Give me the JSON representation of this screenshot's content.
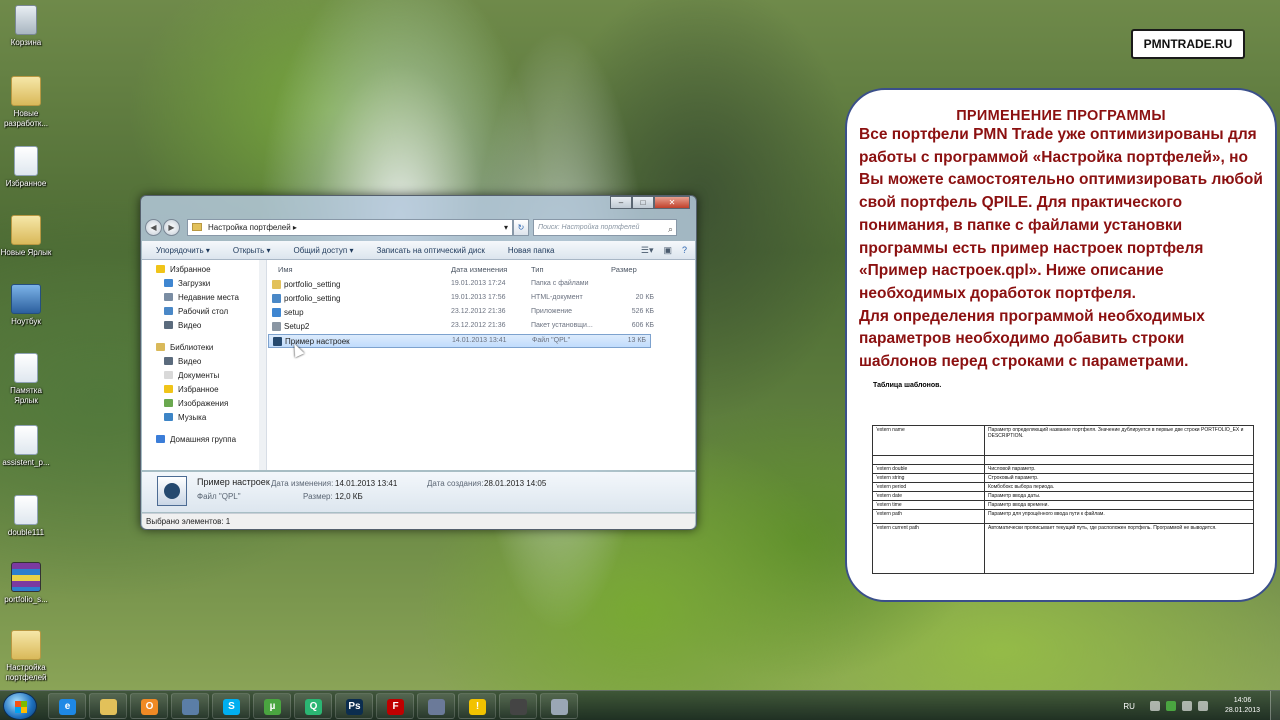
{
  "desktop_icons": [
    {
      "label": "Корзина",
      "kind": "bin"
    },
    {
      "label": "Новые разработк...",
      "kind": "folder"
    },
    {
      "label": "Избранное",
      "kind": "doc"
    },
    {
      "label": "Новые Ярлык",
      "kind": "folder"
    },
    {
      "label": "Ноутбук",
      "kind": "pc"
    },
    {
      "label": "Памятка Ярлык",
      "kind": "doc"
    },
    {
      "label": "assistent_p...",
      "kind": "doc"
    },
    {
      "label": "double111",
      "kind": "doc"
    },
    {
      "label": "portfolio_s...",
      "kind": "zip"
    },
    {
      "label": "Настройка портфелей",
      "kind": "folder"
    }
  ],
  "badge": "PMNTRADE.RU",
  "info": {
    "heading": "ПРИМЕНЕНИЕ ПРОГРАММЫ",
    "paragraph1": "Все портфели PMN Trade уже оптимизированы для работы с программой «Настройка портфелей», но Вы можете самостоятельно оптимизировать любой свой портфель QPILE. Для практического понимания, в папке с файлами установки программы есть пример настроек портфеля «Пример настроек.qpl». Ниже описание необходимых доработок портфеля.",
    "paragraph2": "Для определения программой необходимых параметров необходимо добавить строки шаблонов перед строками с параметрами.",
    "table_title": "Таблица шаблонов.",
    "table_rows": [
      {
        "key": "'extern name",
        "desc": "Параметр определяющий название портфеля. Значение дублируется в первые две строки PORTFOLIO_EX и DESCRIPTION."
      },
      {
        "key": "",
        "desc": ""
      },
      {
        "key": "'extern double",
        "desc": "Числовой параметр."
      },
      {
        "key": "'extern string",
        "desc": "Строковый параметр."
      },
      {
        "key": "'extern period",
        "desc": "Комбобокс выбора периода."
      },
      {
        "key": "'extern date",
        "desc": "Параметр ввода даты."
      },
      {
        "key": "'extern time",
        "desc": "Параметр ввода времени."
      },
      {
        "key": "'extern path",
        "desc": "Параметр для упрощённого ввода пути к файлам."
      },
      {
        "key": "'extern current path",
        "desc": "Автоматически прописывает текущий путь, где расположен портфель. Программой не выводится."
      }
    ]
  },
  "explorer": {
    "address": "Настройка портфелей",
    "search_placeholder": "Поиск: Настройка портфелей",
    "toolbar": [
      "Упорядочить ▾",
      "Открыть ▾",
      "Общий доступ ▾",
      "Записать на оптический диск",
      "Новая папка"
    ],
    "nav": [
      {
        "label": "Избранное",
        "level": 0,
        "color": "#f0c419"
      },
      {
        "label": "Загрузки",
        "level": 1,
        "color": "#3f86d1"
      },
      {
        "label": "Недавние места",
        "level": 1,
        "color": "#7a8da3"
      },
      {
        "label": "Рабочий стол",
        "level": 1,
        "color": "#4a88c7"
      },
      {
        "label": "Видео",
        "level": 1,
        "color": "#5b6b7d"
      },
      {
        "label": "",
        "level": -1,
        "color": ""
      },
      {
        "label": "Библиотеки",
        "level": 0,
        "color": "#d9b95a"
      },
      {
        "label": "Видео",
        "level": 1,
        "color": "#5b6b7d"
      },
      {
        "label": "Документы",
        "level": 1,
        "color": "#d9d9d9"
      },
      {
        "label": "Избранное",
        "level": 1,
        "color": "#f0c419"
      },
      {
        "label": "Изображения",
        "level": 1,
        "color": "#6aa84f"
      },
      {
        "label": "Музыка",
        "level": 1,
        "color": "#3d85c6"
      },
      {
        "label": "",
        "level": -1,
        "color": ""
      },
      {
        "label": "Домашняя группа",
        "level": 0,
        "color": "#3b7dd8"
      }
    ],
    "columns": {
      "name": "Имя",
      "date": "Дата изменения",
      "type": "Тип",
      "size": "Размер"
    },
    "files": [
      {
        "name": "portfolio_setting",
        "date": "19.01.2013 17:24",
        "type": "Папка с файлами",
        "size": "",
        "color": "#e2c15a",
        "selected": false
      },
      {
        "name": "portfolio_setting",
        "date": "19.01.2013 17:56",
        "type": "HTML-документ",
        "size": "20 КБ",
        "color": "#4a88c7",
        "selected": false
      },
      {
        "name": "setup",
        "date": "23.12.2012 21:36",
        "type": "Приложение",
        "size": "526 КБ",
        "color": "#3f86d1",
        "selected": false
      },
      {
        "name": "Setup2",
        "date": "23.12.2012 21:36",
        "type": "Пакет установщи...",
        "size": "606 КБ",
        "color": "#8a96a3",
        "selected": false
      },
      {
        "name": "Пример настроек",
        "date": "14.01.2013 13:41",
        "type": "Файл \"QPL\"",
        "size": "13 КБ",
        "color": "#25496f",
        "selected": true
      }
    ],
    "details": {
      "name": "Пример настроек",
      "type": "Файл \"QPL\"",
      "modified_label": "Дата изменения:",
      "modified": "14.01.2013 13:41",
      "size_label": "Размер:",
      "size": "12,0 КБ",
      "created_label": "Дата создания:",
      "created": "28.01.2013 14:05"
    },
    "status": "Выбрано элементов: 1"
  },
  "taskbar": {
    "apps": [
      {
        "name": "ie",
        "glyph": "e",
        "color": "#1e88e5"
      },
      {
        "name": "explorer",
        "glyph": "",
        "color": "#e2c15a"
      },
      {
        "name": "outlook",
        "glyph": "O",
        "color": "#f08a24"
      },
      {
        "name": "network",
        "glyph": "",
        "color": "#5b7ea6"
      },
      {
        "name": "skype",
        "glyph": "S",
        "color": "#00aff0"
      },
      {
        "name": "utorrent",
        "glyph": "µ",
        "color": "#4aa540"
      },
      {
        "name": "qip",
        "glyph": "Q",
        "color": "#2bb673"
      },
      {
        "name": "photoshop",
        "glyph": "Ps",
        "color": "#0b2d4f"
      },
      {
        "name": "filezilla",
        "glyph": "F",
        "color": "#bf0000"
      },
      {
        "name": "settings-tool",
        "glyph": "",
        "color": "#6b7a99"
      },
      {
        "name": "warning-tool",
        "glyph": "!",
        "color": "#f2c200"
      },
      {
        "name": "video",
        "glyph": "",
        "color": "#444"
      },
      {
        "name": "window",
        "glyph": "",
        "color": "#9aa7b5"
      }
    ],
    "language": "RU",
    "time": "14:06",
    "date": "28.01.2013"
  }
}
